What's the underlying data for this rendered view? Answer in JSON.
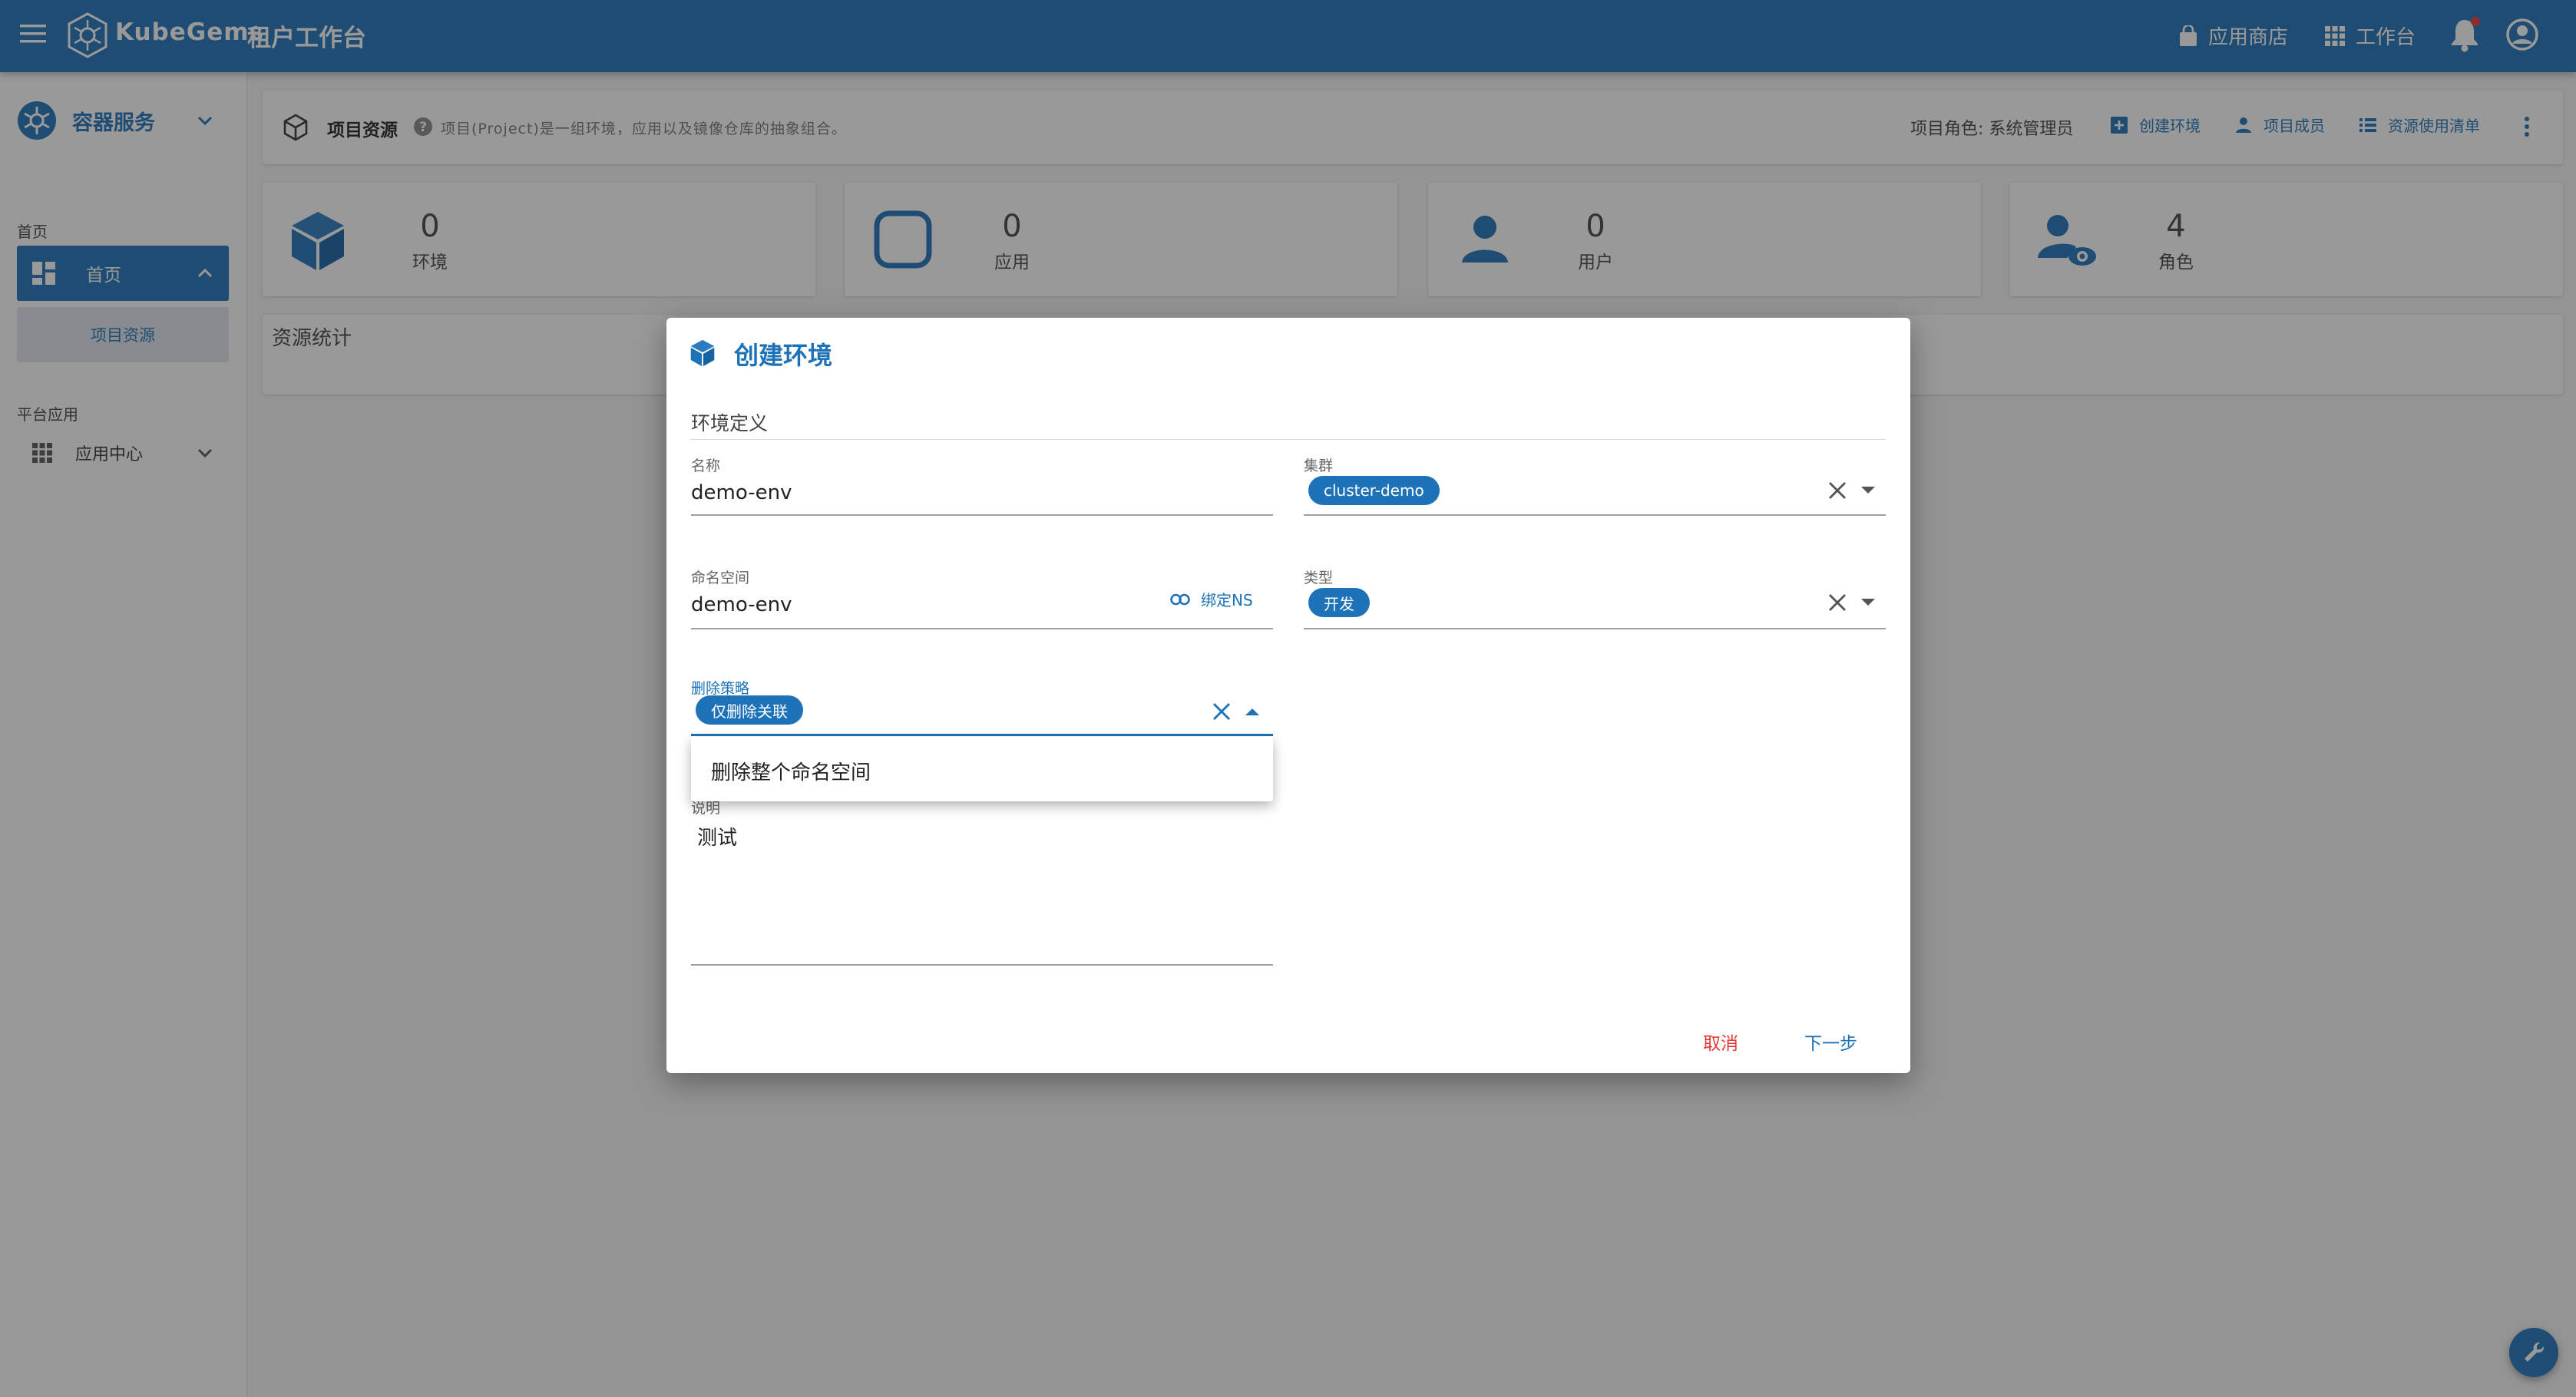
{
  "header": {
    "brand": "KubeGems",
    "subtitle": "租户工作台",
    "app_store": "应用商店",
    "workbench": "工作台"
  },
  "sidebar": {
    "service_title": "容器服务",
    "section_home": "首页",
    "home_item": "首页",
    "home_sub_item": "项目资源",
    "section_platform": "平台应用",
    "app_center": "应用中心"
  },
  "toolbar": {
    "title": "项目资源",
    "description": "项目(Project)是一组环境，应用以及镜像仓库的抽象组合。",
    "role": "项目角色: 系统管理员",
    "create_env": "创建环境",
    "members": "项目成员",
    "usage_list": "资源使用清单"
  },
  "stats": [
    {
      "value": "0",
      "label": "环境"
    },
    {
      "value": "0",
      "label": "应用"
    },
    {
      "value": "0",
      "label": "用户"
    },
    {
      "value": "4",
      "label": "角色"
    }
  ],
  "resource_stats_title": "资源统计",
  "dialog": {
    "title": "创建环境",
    "section_title": "环境定义",
    "name": {
      "label": "名称",
      "value": "demo-env"
    },
    "cluster": {
      "label": "集群",
      "value": "cluster-demo"
    },
    "namespace": {
      "label": "命名空间",
      "value": "demo-env",
      "bind_label": "绑定NS"
    },
    "type": {
      "label": "类型",
      "value": "开发"
    },
    "delete_policy": {
      "label": "删除策略",
      "value": "仅删除关联"
    },
    "description": {
      "label": "说明",
      "value": "测试"
    },
    "menu_option": "删除整个命名空间",
    "cancel": "取消",
    "next": "下一步"
  },
  "colors": {
    "primary": "#1e72b8",
    "danger": "#e53935"
  }
}
